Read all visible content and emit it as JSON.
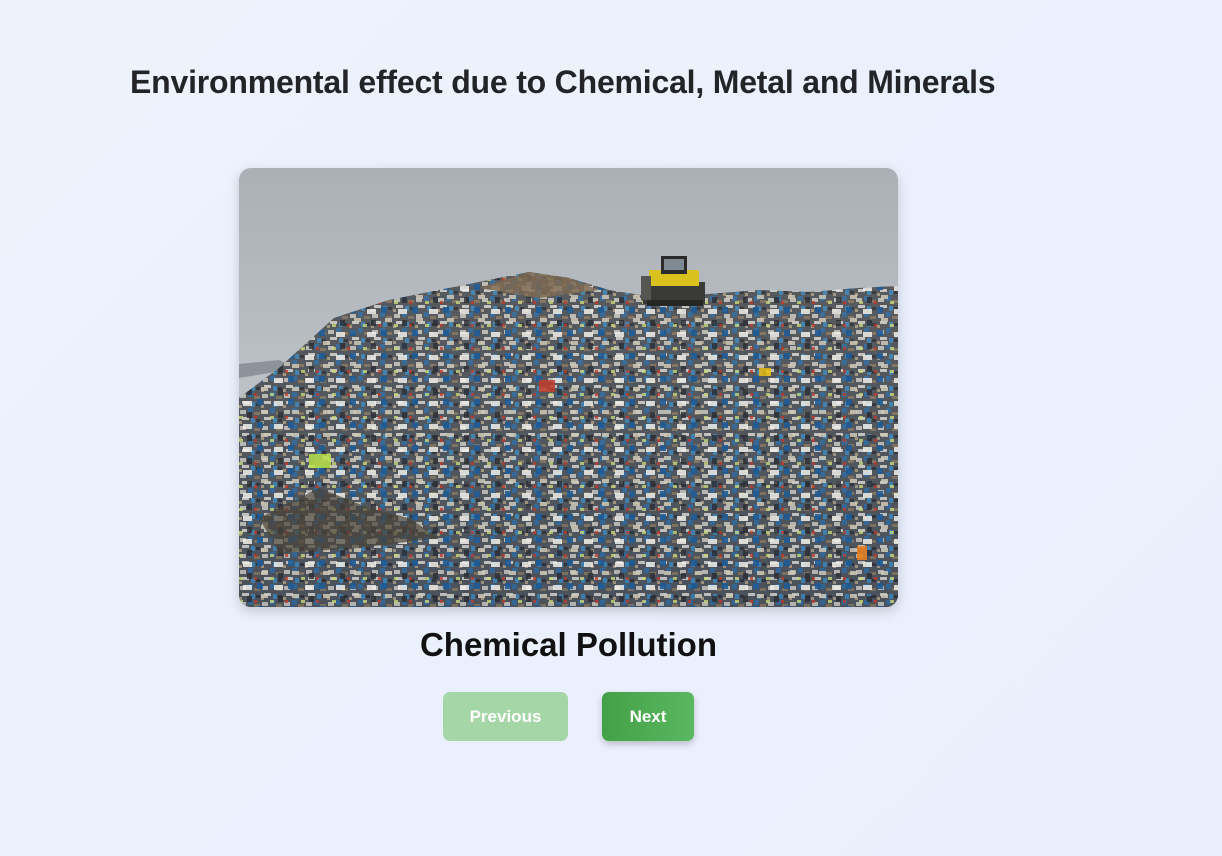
{
  "page": {
    "title": "Environmental effect due to Chemical, Metal and Minerals"
  },
  "slideshow": {
    "image_alt": "Landfill with a bulldozer on a mountain of mixed waste",
    "caption": "Chemical Pollution",
    "previous_label": "Previous",
    "next_label": "Next",
    "previous_disabled": true
  },
  "colors": {
    "accent": "#43a047",
    "accent_disabled": "#a5d6a7",
    "background": "#eef2fb",
    "text": "#222428"
  }
}
